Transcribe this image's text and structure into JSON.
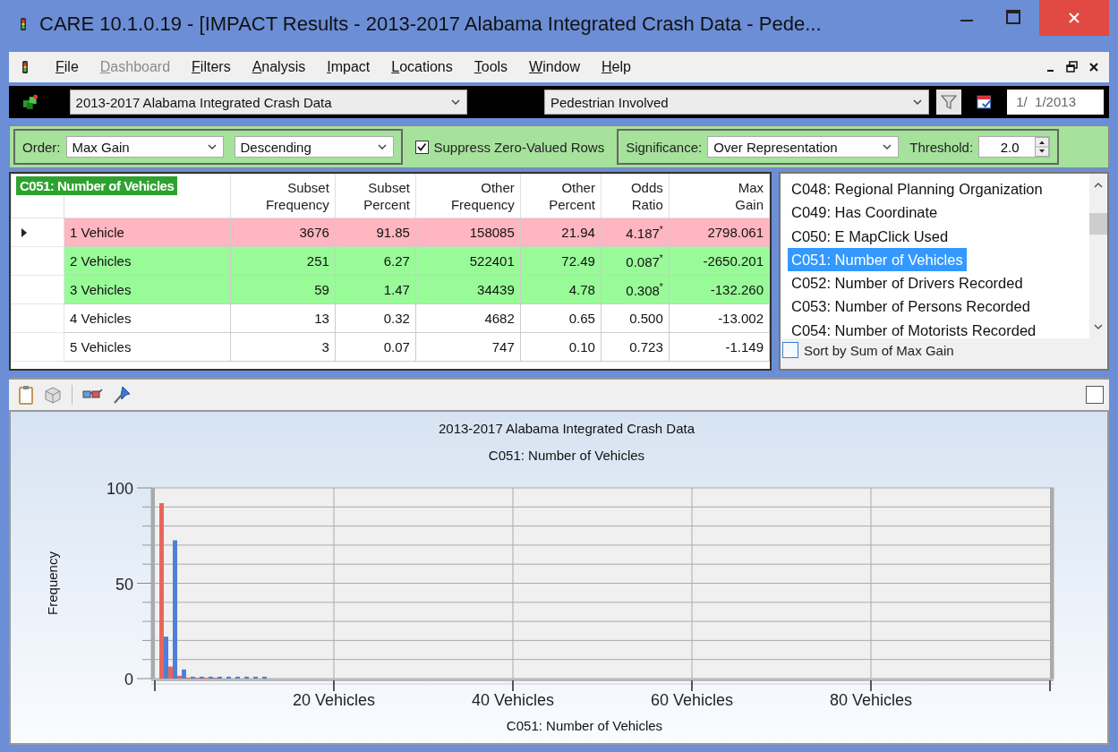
{
  "window": {
    "title": "CARE 10.1.0.19 - [IMPACT Results - 2013-2017 Alabama Integrated Crash Data - Pede..."
  },
  "menu": [
    {
      "label": "File",
      "disabled": false
    },
    {
      "label": "Dashboard",
      "disabled": true
    },
    {
      "label": "Filters",
      "disabled": false
    },
    {
      "label": "Analysis",
      "disabled": false
    },
    {
      "label": "Impact",
      "disabled": false
    },
    {
      "label": "Locations",
      "disabled": false
    },
    {
      "label": "Tools",
      "disabled": false
    },
    {
      "label": "Window",
      "disabled": false
    },
    {
      "label": "Help",
      "disabled": false
    }
  ],
  "toolbar": {
    "dataset": "2013-2017 Alabama Integrated Crash Data",
    "filter": "Pedestrian Involved",
    "date": "1/  1/2013"
  },
  "options": {
    "order_label": "Order:",
    "order": "Max Gain",
    "direction": "Descending",
    "suppress_zero": {
      "label": "Suppress Zero-Valued Rows",
      "checked": true
    },
    "significance_label": "Significance:",
    "significance": "Over Representation",
    "threshold_label": "Threshold:",
    "threshold": "2.0"
  },
  "table": {
    "caption": "C051: Number of Vehicles",
    "columns": [
      "",
      "",
      "Subset\nFrequency",
      "Subset\nPercent",
      "Other\nFrequency",
      "Other\nPercent",
      "Odds\nRatio",
      "Max\nGain"
    ],
    "rows": [
      {
        "current": true,
        "color": "#ffb6c1",
        "cells": [
          "",
          "1 Vehicle",
          "3676",
          "91.85",
          "158085",
          "21.94",
          "4.187$^{*}$",
          "2798.061"
        ]
      },
      {
        "current": false,
        "color": "#98fb98",
        "cells": [
          "",
          "2 Vehicles",
          "251",
          "6.27",
          "522401",
          "72.49",
          "0.087$^{*}$",
          "-2650.201"
        ]
      },
      {
        "current": false,
        "color": "#98fb98",
        "cells": [
          "",
          "3 Vehicles",
          "59",
          "1.47",
          "34439",
          "4.78",
          "0.308$^{*}$",
          "-132.260"
        ]
      },
      {
        "current": false,
        "color": "#ffffff",
        "cells": [
          "",
          "4 Vehicles",
          "13",
          "0.32",
          "4682",
          "0.65",
          "0.500",
          "-13.002"
        ]
      },
      {
        "current": false,
        "color": "#ffffff",
        "cells": [
          "",
          "5 Vehicles",
          "3",
          "0.07",
          "747",
          "0.10",
          "0.723",
          "-1.149"
        ]
      }
    ]
  },
  "variables": {
    "items": [
      {
        "label": "C048: Regional Planning Organization",
        "selected": false
      },
      {
        "label": "C049: Has Coordinate",
        "selected": false
      },
      {
        "label": "C050: E MapClick Used",
        "selected": false
      },
      {
        "label": "C051: Number of Vehicles",
        "selected": true
      },
      {
        "label": "C052: Number of Drivers Recorded",
        "selected": false
      },
      {
        "label": "C053: Number of Persons Recorded",
        "selected": false
      },
      {
        "label": "C054: Number of Motorists Recorded",
        "selected": false
      }
    ],
    "sort_by_sum": {
      "label": "Sort by Sum of Max Gain",
      "checked": false
    }
  },
  "chart_panel": {
    "toggle": {
      "checked": false
    },
    "chart_data": {
      "type": "bar",
      "title": "2013-2017 Alabama Integrated Crash Data\nC051: Number of Vehicles",
      "xlabel": "C051: Number of Vehicles",
      "ylabel": "Frequency",
      "x": [
        1,
        2,
        3,
        4,
        5,
        6,
        7,
        8,
        9,
        10,
        11,
        12
      ],
      "series": [
        {
          "color": "#e8675a",
          "values": [
            92,
            6.3,
            1.5,
            0.5,
            0.5,
            0.5,
            0.5,
            null,
            null,
            null,
            null,
            null
          ]
        },
        {
          "color": "#4f7fd6",
          "values": [
            22,
            72.5,
            4.8,
            1,
            1,
            1,
            1,
            1,
            1,
            1,
            1,
            1
          ]
        }
      ],
      "grid": true,
      "xlim": [
        0,
        100
      ],
      "ylim": [
        0,
        100
      ],
      "yticks": [
        0,
        50,
        100
      ],
      "xticks": [
        {
          "value": 20,
          "label": "20 Vehicles"
        },
        {
          "value": 40,
          "label": "40 Vehicles"
        },
        {
          "value": 60,
          "label": "60 Vehicles"
        },
        {
          "value": 80,
          "label": "80 Vehicles"
        }
      ]
    }
  }
}
